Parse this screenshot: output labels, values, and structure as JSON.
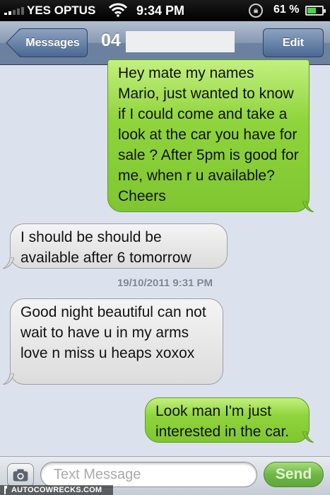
{
  "status_bar": {
    "carrier": "YES OPTUS",
    "time": "9:34 PM",
    "battery": "61 %",
    "battery_level": 0.61
  },
  "nav": {
    "back_label": "Messages",
    "title": "04",
    "edit_label": "Edit"
  },
  "messages": [
    {
      "direction": "sent",
      "text": "Hey mate my names Mario, just wanted to know if I could come and take a look at the car you have for sale ? After 5pm is good for me, when r u available? Cheers"
    },
    {
      "direction": "received",
      "text": "I should be should be available after 6 tomorrow"
    },
    {
      "direction": "received",
      "text": "Good night beautiful can not wait to have u in my arms love n miss u heaps xoxox"
    },
    {
      "direction": "sent",
      "text": "Look man I'm just interested in the car."
    }
  ],
  "timestamp": "19/10/2011 9:31 PM",
  "input": {
    "placeholder": "Text Message",
    "send_label": "Send"
  },
  "watermark": "AUTOCOWRECKS.COM",
  "colors": {
    "sent_bubble": "#8fd43c",
    "received_bubble": "#e6e6e6",
    "nav_bar": "#6d82a1",
    "background": "#dbe2ed"
  }
}
